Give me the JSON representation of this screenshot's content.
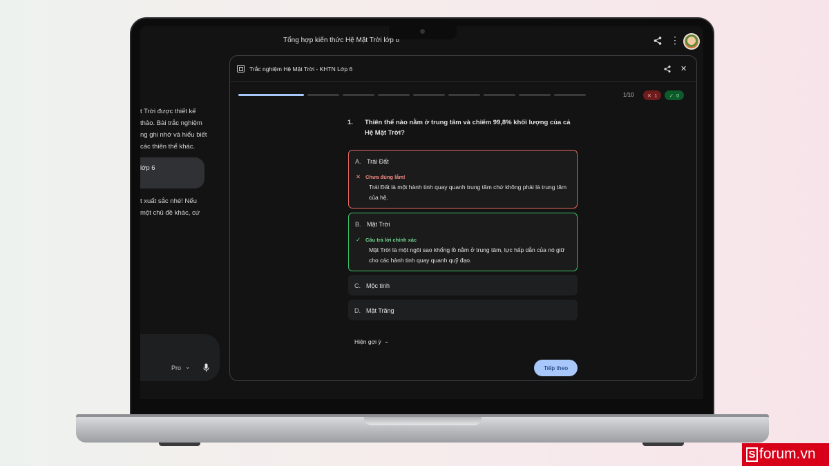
{
  "app": {
    "title": "Tổng hợp kiến thức Hệ Mặt Trời lớp 6",
    "top_icons": [
      "share-icon",
      "more-vert-icon",
      "avatar"
    ]
  },
  "chat": {
    "paragraph1": [
      "t Trời được thiết kế",
      "thảo. Bài trắc nghiệm",
      "ng ghi nhớ và hiểu biết",
      "các thiên thể khác."
    ],
    "bubble": "lớp 6",
    "paragraph2": [
      "t xuất sắc nhé! Nếu",
      "một chủ đề khác, cứ"
    ],
    "model_label": "Pro",
    "icons": [
      "chevron-down-icon",
      "mic-icon"
    ]
  },
  "quiz": {
    "title": "Trắc nghiệm Hệ Mặt Trời - KHTN Lớp 6",
    "progress_text": "1/10",
    "progress_current": 1,
    "progress_total": 10,
    "wrong_count": "1",
    "right_count": "0",
    "question_number": "1.",
    "question_text": "Thiên thể nào nằm ở trung tâm và chiếm 99,8% khối lượng của cả Hệ Mặt Trời?",
    "options": [
      {
        "letter": "A.",
        "label": "Trái Đất",
        "state": "wrong",
        "feedback_title": "Chưa đúng lắm!",
        "feedback_body": "Trái Đất là một hành tinh quay quanh trung tâm chứ không phải là trung tâm của hệ."
      },
      {
        "letter": "B.",
        "label": "Mặt Trời",
        "state": "correct",
        "feedback_title": "Câu trả lời chính xác",
        "feedback_body": "Mặt Trời là một ngôi sao khổng lồ nằm ở trung tâm, lực hấp dẫn của nó giữ cho các hành tinh quay quanh quỹ đạo."
      },
      {
        "letter": "C.",
        "label": "Mộc tinh",
        "state": "none"
      },
      {
        "letter": "D.",
        "label": "Mặt Trăng",
        "state": "none"
      }
    ],
    "hint_label": "Hiện gợi ý",
    "next_label": "Tiếp theo",
    "colors": {
      "wrong": "#e46962",
      "correct": "#3ec16a",
      "accent": "#a8c7fa"
    }
  },
  "watermark": {
    "brand": "forum.vn",
    "mark": "S"
  }
}
